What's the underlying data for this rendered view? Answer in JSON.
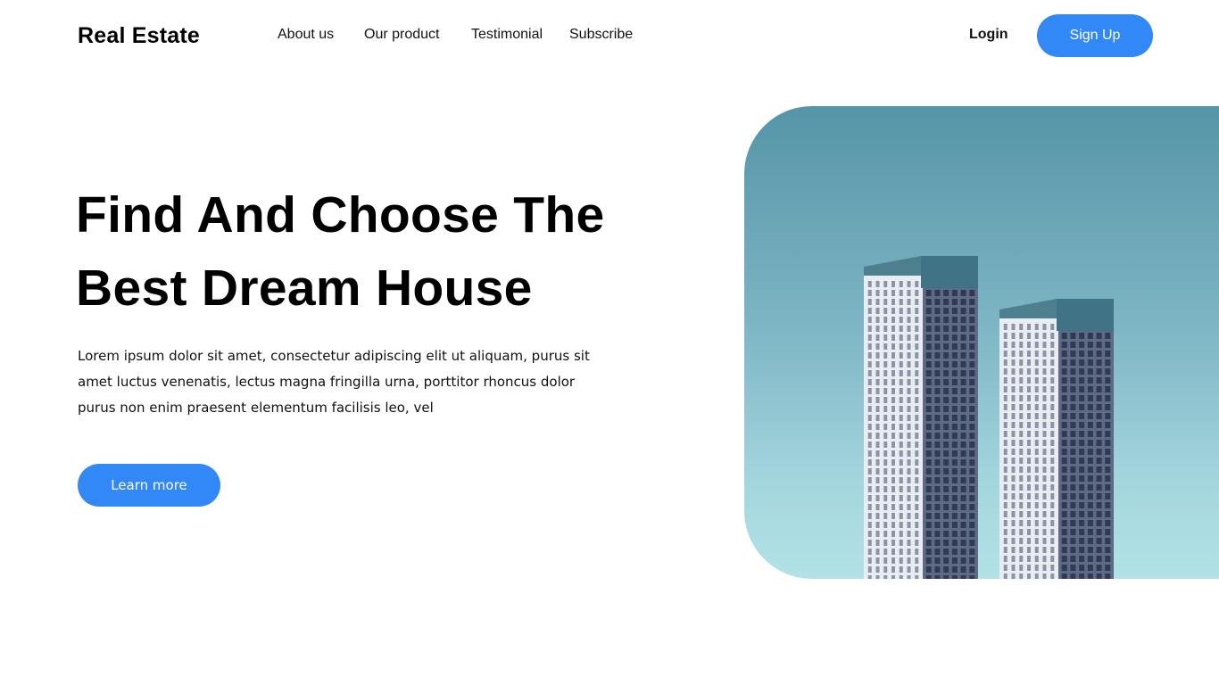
{
  "header": {
    "logo": "Real Estate",
    "nav": [
      "About us",
      "Our product",
      "Testimonial",
      "Subscribe"
    ],
    "login_label": "Login",
    "signup_label": "Sign Up"
  },
  "hero": {
    "title_line1": "Find And Choose The",
    "title_line2": "Best Dream House",
    "description": "Lorem ipsum dolor sit amet, consectetur adipiscing elit ut aliquam, purus sit amet luctus venenatis, lectus magna fringilla urna, porttitor rhoncus dolor purus non enim praesent elementum facilisis leo, vel",
    "cta_label": "Learn more",
    "image": "twin-skyscrapers-photo"
  },
  "colors": {
    "accent": "#3388f8",
    "sky_top": "#5595a7",
    "sky_bottom": "#b2e2e6"
  }
}
